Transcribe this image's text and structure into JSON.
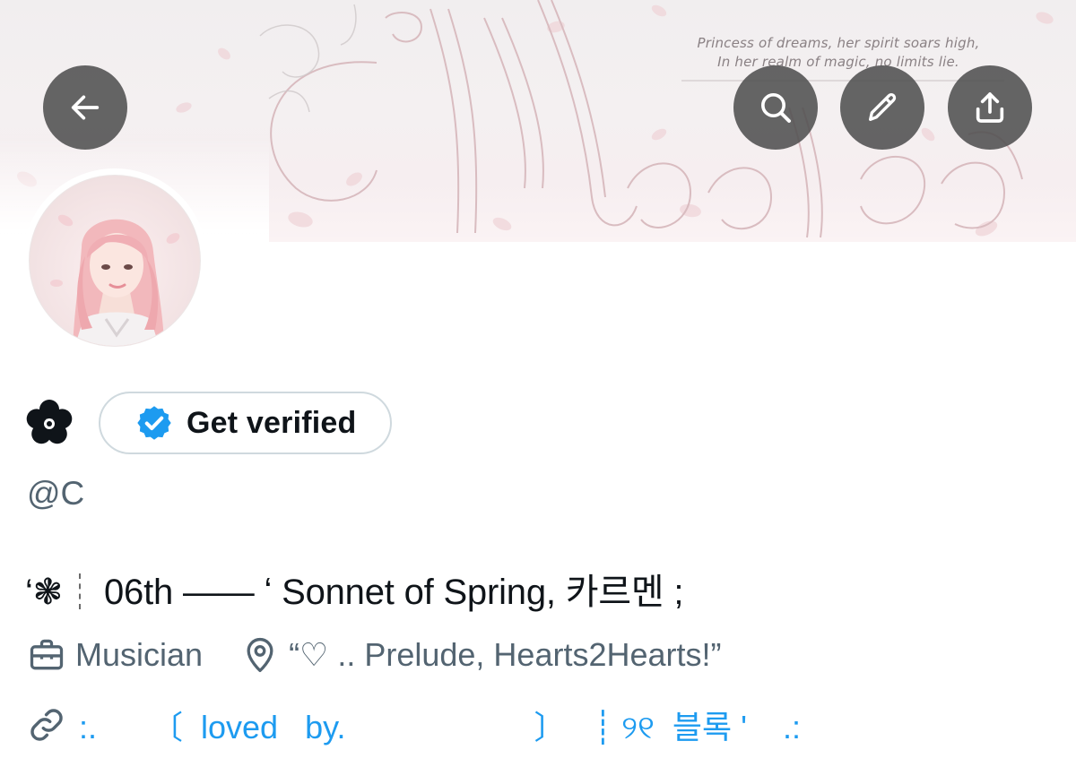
{
  "banner": {
    "quote_line1": "Princess of dreams, her spirit soars high,",
    "quote_line2": "In her realm of magic, no limits lie."
  },
  "header": {
    "back_icon": "arrow-left-icon",
    "search_icon": "search-icon",
    "edit_icon": "pencil-icon",
    "share_icon": "share-upload-icon"
  },
  "profile": {
    "display_name_icon": "flower-icon",
    "verify_label": "Get verified",
    "handle": "@C",
    "bio_prefix": "‘❃",
    "bio_text": "06th —— ʻ Sonnet of Spring, 카르멘 ;",
    "profession": "Musician",
    "location": "“♡ .. Prelude, Hearts2Hearts!”",
    "link": ":.      〔  loved   by.                     〕   ┊ ୨୧  블록 '    .:"
  },
  "colors": {
    "accent": "#1d9bf0",
    "secondary_text": "#536471",
    "pill_border": "#cfd9de",
    "overlay_button": "#505050"
  }
}
